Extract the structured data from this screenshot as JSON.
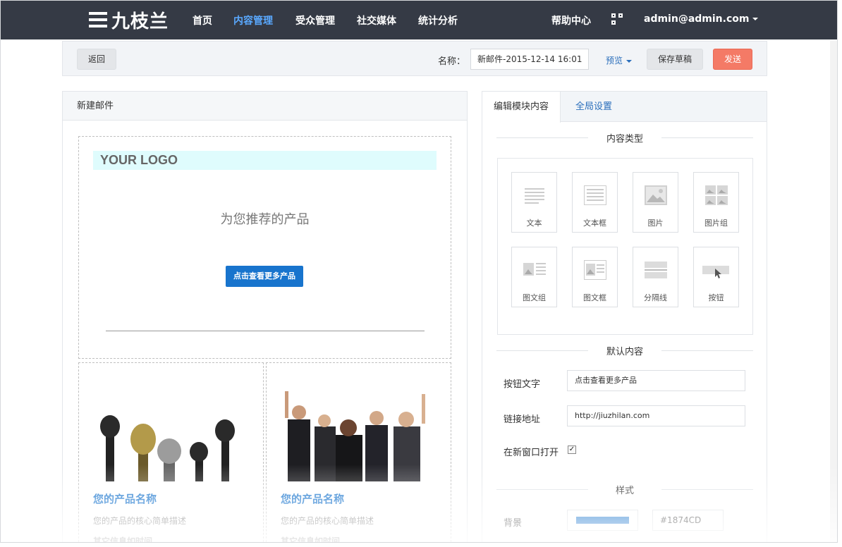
{
  "nav": {
    "brand": "九枝兰",
    "items": [
      "首页",
      "内容管理",
      "受众管理",
      "社交媒体",
      "统计分析"
    ],
    "active_index": 1,
    "help": "帮助中心",
    "user": "admin@admin.com",
    "qr_icon": "qr-code-icon"
  },
  "toolbar": {
    "back": "返回",
    "name_label": "名称：",
    "name_value": "新邮件-2015-12-14 16:01",
    "preview": "预览",
    "save_draft": "保存草稿",
    "send": "发送"
  },
  "editor": {
    "header": "新建邮件",
    "logo_text": "YOUR LOGO",
    "recommend": "为您推荐的产品",
    "cta": "点击查看更多产品",
    "products": [
      {
        "name": "您的产品名称",
        "desc": "您的产品的核心简单描述",
        "more": "其它信息如时间"
      },
      {
        "name": "您的产品名称",
        "desc": "您的产品的核心简单描述",
        "more": "其它信息如时间"
      }
    ]
  },
  "panel": {
    "tabs": [
      "编辑模块内容",
      "全局设置"
    ],
    "content_type_title": "内容类型",
    "types": [
      "文本",
      "文本框",
      "图片",
      "图片组",
      "图文组",
      "图文框",
      "分隔线",
      "按钮"
    ],
    "default_title": "默认内容",
    "button_text_label": "按钮文字",
    "button_text_value": "点击查看更多产品",
    "link_label": "链接地址",
    "link_value": "http://jiuzhilan.com",
    "new_window_label": "在新窗口打开",
    "new_window_checked": true,
    "style_title": "样式",
    "bg_label": "背景",
    "bg_color": "#1874CD"
  },
  "colors": {
    "nav_bg": "#353a45",
    "accent": "#1874cd",
    "send": "#f47a66"
  }
}
